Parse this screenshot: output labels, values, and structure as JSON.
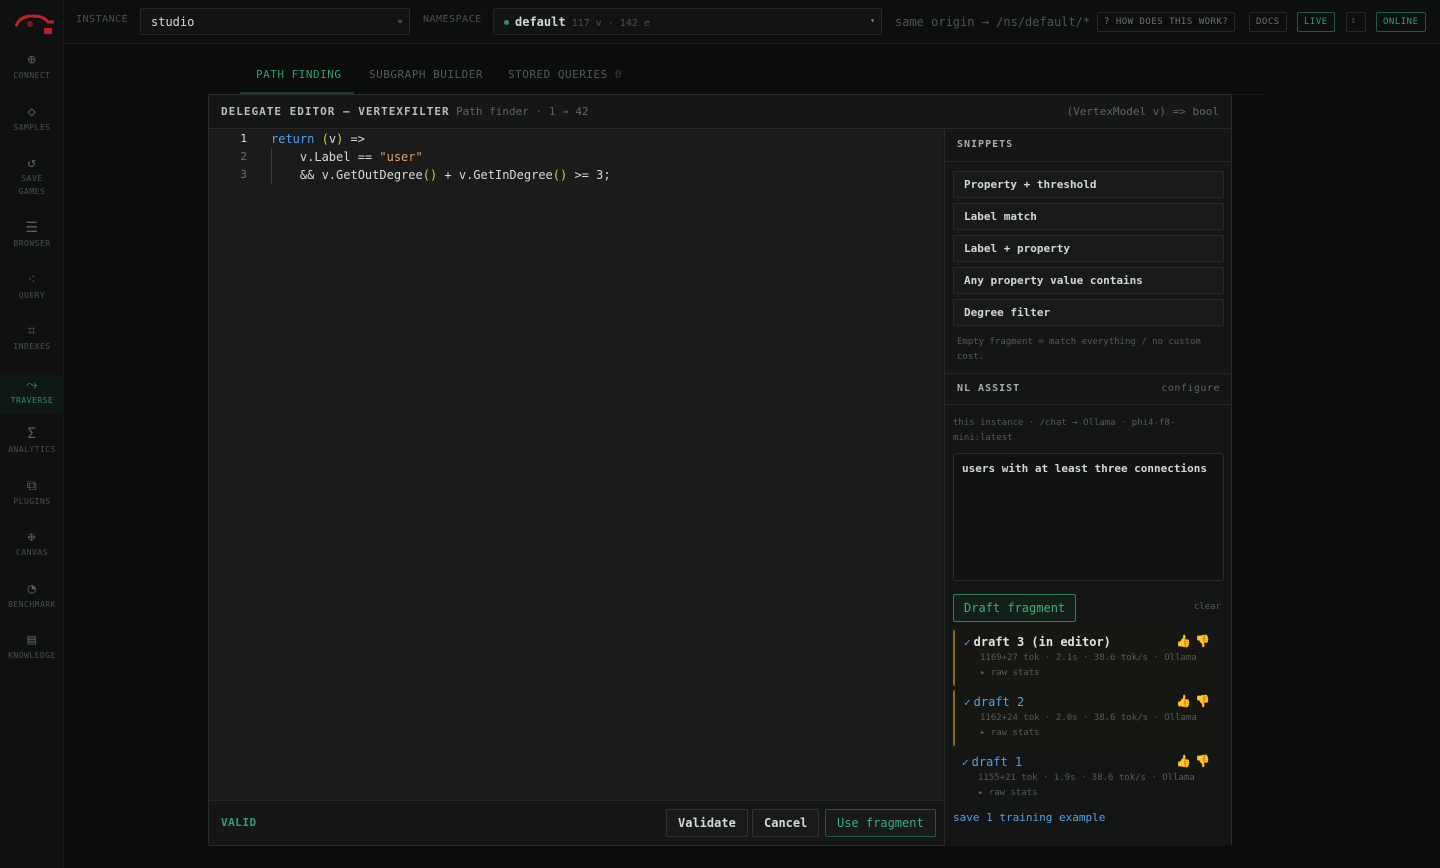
{
  "rail": {
    "items": [
      {
        "label": "CONNECT",
        "icon": "⊕"
      },
      {
        "label": "SAMPLES",
        "icon": "◇"
      },
      {
        "label": "SAVE\nGAMES",
        "icon": "↺"
      },
      {
        "label": "BROWSER",
        "icon": "☰"
      },
      {
        "label": "QUERY",
        "icon": "⁖"
      },
      {
        "label": "INDEXES",
        "icon": "⌗"
      },
      {
        "label": "TRAVERSE",
        "icon": "⤳"
      },
      {
        "label": "ANALYTICS",
        "icon": "Σ"
      },
      {
        "label": "PLUGINS",
        "icon": "⧉"
      },
      {
        "label": "CANVAS",
        "icon": "❉"
      },
      {
        "label": "BENCHMARK",
        "icon": "◔"
      },
      {
        "label": "KNOWLEDGE",
        "icon": "▤"
      }
    ],
    "active": "TRAVERSE"
  },
  "topbar": {
    "instance_label": "INSTANCE",
    "instance_value": "studio",
    "namespace_label": "NAMESPACE",
    "namespace_value": "default",
    "namespace_meta": "117 v · 142 e",
    "origin": "same origin → /ns/default/*",
    "how_label": "? HOW DOES THIS WORK?",
    "docs_label": "DOCS",
    "live_label": "LIVE",
    "online_label": "ONLINE",
    "accent": "#2f9c72"
  },
  "tabs": [
    {
      "label": "PATH FINDING"
    },
    {
      "label": "SUBGRAPH BUILDER"
    },
    {
      "label": "STORED QUERIES",
      "count": "0"
    }
  ],
  "modal": {
    "title": "DELEGATE EDITOR — VERTEXFILTER",
    "subtitle": "Path finder · 1 → 42",
    "signature": "(VertexModel v) => bool",
    "code_lines": [
      {
        "n": "1"
      },
      {
        "n": "2"
      },
      {
        "n": "3"
      }
    ],
    "status": "VALID",
    "validate_label": "Validate",
    "cancel_label": "Cancel",
    "use_label": "Use fragment"
  },
  "snippets": {
    "header": "SNIPPETS",
    "items": [
      "Property + threshold",
      "Label match",
      "Label + property",
      "Any property value contains",
      "Degree filter"
    ],
    "note": "Empty fragment = match everything / no custom cost."
  },
  "nl_assist": {
    "header": "NL ASSIST",
    "configure_label": "configure",
    "source": "this instance · /chat → Ollama · phi4-f8-mini:latest",
    "prompt": "users with at least three connections",
    "draft_label": "Draft fragment",
    "clear_label": "clear",
    "drafts": [
      {
        "title": "draft 3 (in editor)",
        "meta": "1169+27 tok · 2.1s · 38.6 tok/s · Ollama",
        "raw": "▸ raw stats"
      },
      {
        "title": "draft 2",
        "meta": "1162+24 tok · 2.0s · 38.6 tok/s · Ollama",
        "raw": "▸ raw stats"
      },
      {
        "title": "draft 1",
        "meta": "1155+21 tok · 1.9s · 38.6 tok/s · Ollama",
        "raw": "▸ raw stats"
      }
    ],
    "save_label": "save 1 training example"
  }
}
